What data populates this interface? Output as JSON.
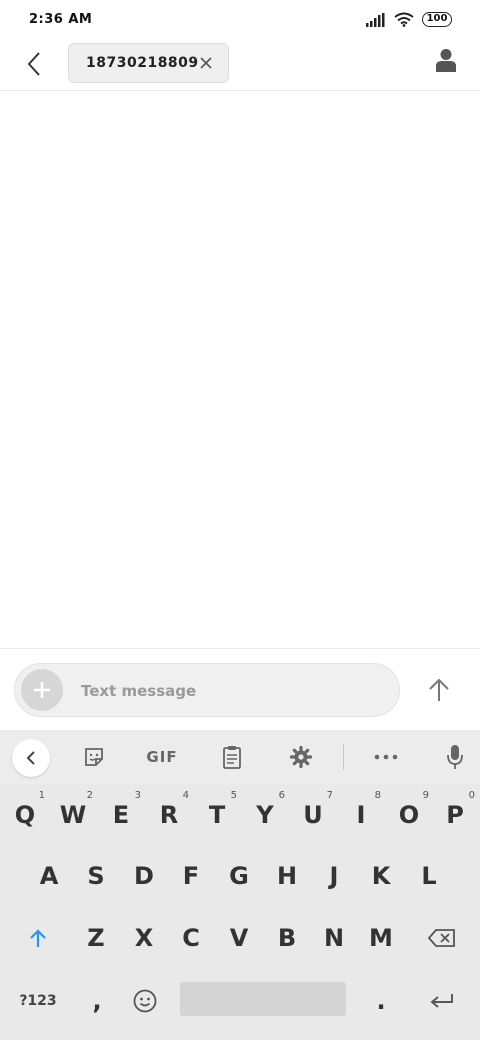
{
  "status_bar": {
    "time": "2:36 AM",
    "battery": "100"
  },
  "header": {
    "recipient": "18730218809"
  },
  "compose": {
    "placeholder": "Text message"
  },
  "keyboard": {
    "toolbar": {
      "gif_label": "GIF"
    },
    "row1": [
      {
        "label": "Q",
        "hint": "1"
      },
      {
        "label": "W",
        "hint": "2"
      },
      {
        "label": "E",
        "hint": "3"
      },
      {
        "label": "R",
        "hint": "4"
      },
      {
        "label": "T",
        "hint": "5"
      },
      {
        "label": "Y",
        "hint": "6"
      },
      {
        "label": "U",
        "hint": "7"
      },
      {
        "label": "I",
        "hint": "8"
      },
      {
        "label": "O",
        "hint": "9"
      },
      {
        "label": "P",
        "hint": "0"
      }
    ],
    "row2": [
      "A",
      "S",
      "D",
      "F",
      "G",
      "H",
      "J",
      "K",
      "L"
    ],
    "row3": [
      "Z",
      "X",
      "C",
      "V",
      "B",
      "N",
      "M"
    ],
    "row4": {
      "symbols": "?123",
      "comma": ",",
      "period": "."
    }
  },
  "colors": {
    "shift_accent": "#2196f3",
    "icon_gray": "#666666"
  }
}
